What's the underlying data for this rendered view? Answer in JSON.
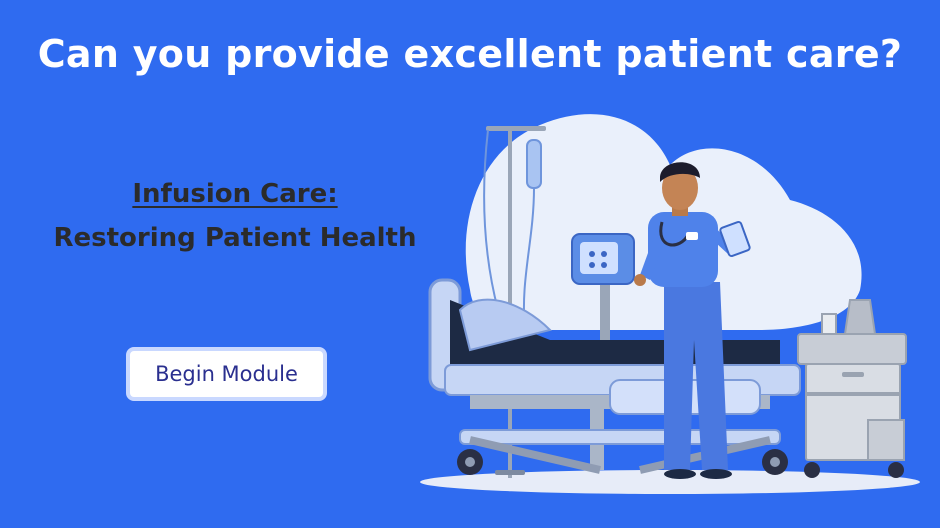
{
  "headline": "Can you provide excellent patient care?",
  "module": {
    "title": "Infusion Care:",
    "subtitle": "Restoring Patient Health"
  },
  "begin_button": {
    "label": "Begin Module"
  },
  "monitor_icon": "vital-signs-monitor-icon",
  "colors": {
    "background": "#2f6bf0",
    "headline_text": "#ffffff",
    "subtitle_text": "#2b2b2b",
    "button_text": "#2a2f8f",
    "button_border": "#c9d8ff"
  }
}
